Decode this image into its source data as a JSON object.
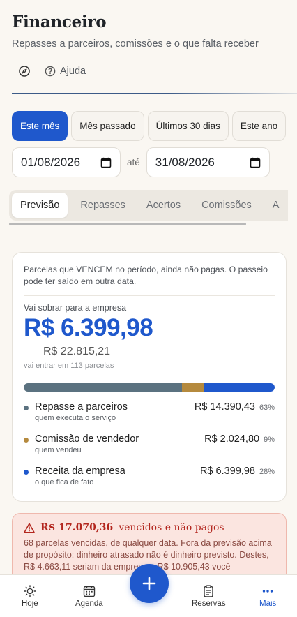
{
  "header": {
    "title": "Financeiro",
    "subtitle": "Repasses a parceiros, comissões e o que falta receber",
    "help_label": "Ajuda"
  },
  "ranges": [
    {
      "label": "Este mês",
      "active": true
    },
    {
      "label": "Mês passado",
      "active": false
    },
    {
      "label": "Últimos 30 dias",
      "active": false
    },
    {
      "label": "Este ano",
      "active": false
    }
  ],
  "dates": {
    "start": "01/08/2026",
    "separator": "até",
    "end": "31/08/2026"
  },
  "tabs": [
    "Previsão",
    "Repasses",
    "Acertos",
    "Comissões",
    "A"
  ],
  "forecast": {
    "note": "Parcelas que VENCEM no período, ainda não pagas. O passeio pode ter saído em outra data.",
    "sobra_label": "Vai sobrar para a empresa",
    "sobra_value": "R$ 6.399,98",
    "gross_value": "R$ 22.815,21",
    "gross_note": "vai entrar em 113 parcelas",
    "breakdown": [
      {
        "label": "Repasse a parceiros",
        "sub": "quem executa o serviço",
        "value": "R$ 14.390,43",
        "pct": "63%",
        "share": 63,
        "color": "#5b7280"
      },
      {
        "label": "Comissão de vendedor",
        "sub": "quem vendeu",
        "value": "R$ 2.024,80",
        "pct": "9%",
        "share": 9,
        "color": "#b58a3e"
      },
      {
        "label": "Receita da empresa",
        "sub": "o que fica de fato",
        "value": "R$ 6.399,98",
        "pct": "28%",
        "share": 28,
        "color": "#1f58cc"
      }
    ]
  },
  "alert": {
    "amount": "R$ 17.070,36",
    "title_rest": "vencidos e não pagos",
    "text": "68 parcelas vencidas, de qualquer data. Fora da previsão acima de propósito: dinheiro atrasado não é dinheiro previsto. Destes, R$ 4.663,11 seriam da empresa e R$ 10.905,43 você"
  },
  "nav": {
    "hoje": "Hoje",
    "agenda": "Agenda",
    "reservas": "Reservas",
    "mais": "Mais"
  },
  "colors": {
    "accent": "#1f58cc",
    "danger": "#b3261e"
  }
}
